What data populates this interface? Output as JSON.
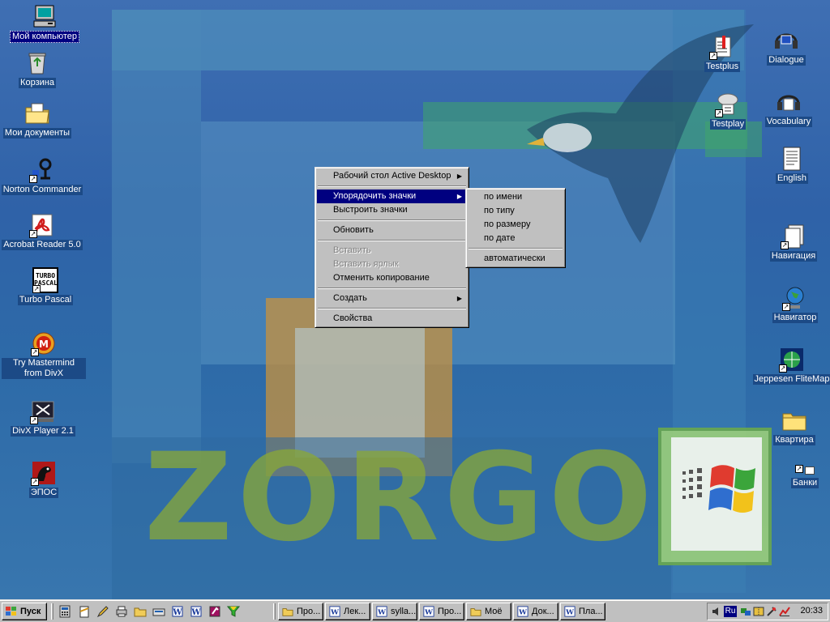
{
  "colors": {
    "desktop": "#2f62a8",
    "menu_highlight": "#000080",
    "menu_bg": "#c0c0c0",
    "label_bg": "#1c4a86"
  },
  "wallpaper": {
    "text": "ZORGO"
  },
  "desktop_icons_left": [
    {
      "label": "Мой компьютер",
      "icon": "my-computer-icon"
    },
    {
      "label": "Корзина",
      "icon": "recycle-bin-icon"
    },
    {
      "label": "Мои документы",
      "icon": "my-documents-icon"
    },
    {
      "label": "Norton Commander",
      "icon": "norton-commander-icon"
    },
    {
      "label": "Acrobat Reader 5.0",
      "icon": "acrobat-reader-icon"
    },
    {
      "label": "Turbo Pascal",
      "icon": "turbo-pascal-icon",
      "icon_text": "TURBO PASCAL"
    },
    {
      "label": "Try Mastermind from DivX",
      "icon": "mastermind-icon"
    },
    {
      "label": "DivX Player 2.1",
      "icon": "divx-player-icon"
    },
    {
      "label": "ЭПОС",
      "icon": "epos-icon"
    }
  ],
  "desktop_icons_right": [
    {
      "label": "Testplus",
      "icon": "testplus-icon"
    },
    {
      "label": "Dialogue",
      "icon": "dialogue-icon"
    },
    {
      "label": "Testplay",
      "icon": "testplay-icon"
    },
    {
      "label": "Vocabulary",
      "icon": "vocabulary-icon"
    },
    {
      "label": "English",
      "icon": "english-document-icon"
    },
    {
      "label": "Навигация",
      "icon": "navigation-document-icon"
    },
    {
      "label": "Навигатор",
      "icon": "navigator-globe-icon"
    },
    {
      "label": "Jeppesen FliteMap",
      "icon": "flitemap-icon"
    },
    {
      "label": "Квартира",
      "icon": "folder-icon"
    },
    {
      "label": "Банки",
      "icon": "shortcut-icon"
    }
  ],
  "context_menu": {
    "items": [
      {
        "label": "Рабочий стол Active Desktop",
        "submenu": true
      },
      {
        "separator": true
      },
      {
        "label": "Упорядочить значки",
        "submenu": true,
        "selected": true
      },
      {
        "label": "Выстроить значки"
      },
      {
        "separator": true
      },
      {
        "label": "Обновить"
      },
      {
        "separator": true
      },
      {
        "label": "Вставить",
        "disabled": true
      },
      {
        "label": "Вставить ярлык",
        "disabled": true
      },
      {
        "label": "Отменить копирование"
      },
      {
        "separator": true
      },
      {
        "label": "Создать",
        "submenu": true
      },
      {
        "separator": true
      },
      {
        "label": "Свойства"
      }
    ],
    "submenu_arrow": "▶"
  },
  "arrange_submenu": {
    "items": [
      {
        "label": "по имени"
      },
      {
        "label": "по типу"
      },
      {
        "label": "по размеру"
      },
      {
        "label": "по дате"
      },
      {
        "separator": true
      },
      {
        "label": "автоматически"
      }
    ]
  },
  "taskbar": {
    "start_label": "Пуск",
    "quick_launch": [
      "calculator-icon",
      "notepad-icon",
      "pencil-icon",
      "printer-icon",
      "folder-icon",
      "keyboard-icon",
      "word-icon",
      "word-icon",
      "access-icon",
      "filter-icon"
    ],
    "tasks": [
      {
        "label": "Про...",
        "icon": "folder-icon"
      },
      {
        "label": "Лек...",
        "icon": "word-icon"
      },
      {
        "label": "sylla...",
        "icon": "word-icon"
      },
      {
        "label": "Про...",
        "icon": "word-icon"
      },
      {
        "label": "Моё",
        "icon": "folder-icon"
      },
      {
        "label": "Док...",
        "icon": "word-icon"
      },
      {
        "label": "Пла...",
        "icon": "word-icon"
      }
    ],
    "tray": {
      "language": "Ru",
      "clock": "20:33"
    }
  }
}
